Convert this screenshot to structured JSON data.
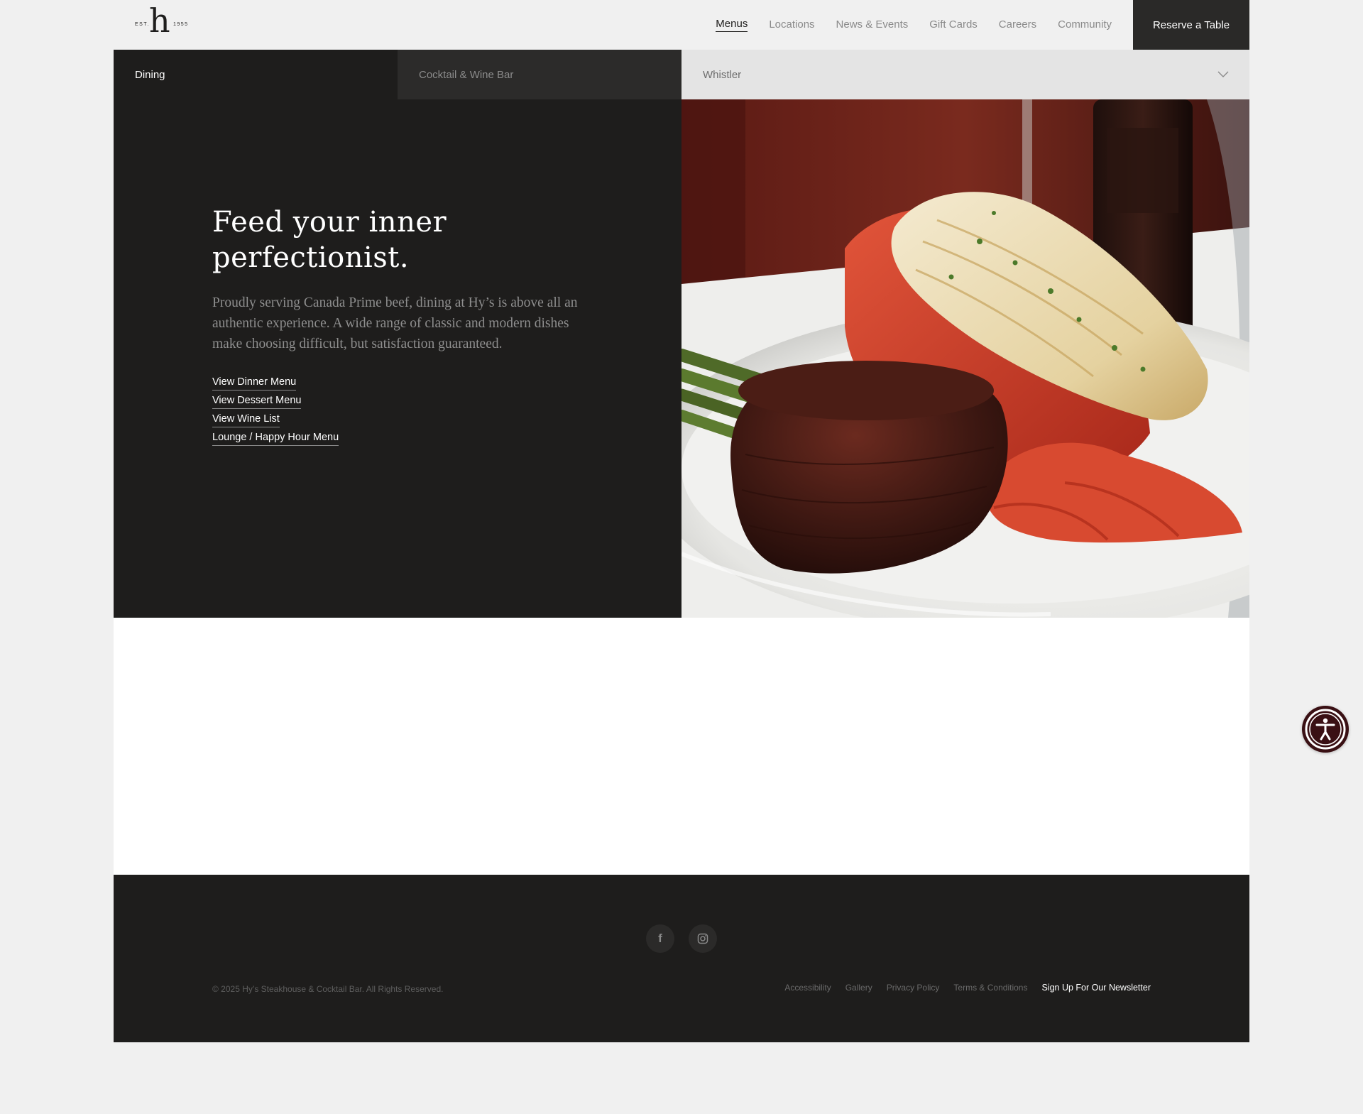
{
  "logo": {
    "est": "EST.",
    "letter": "h",
    "year": "1955"
  },
  "nav": {
    "items": [
      {
        "label": "Menus",
        "active": true
      },
      {
        "label": "Locations"
      },
      {
        "label": "News & Events"
      },
      {
        "label": "Gift Cards"
      },
      {
        "label": "Careers"
      },
      {
        "label": "Community"
      }
    ],
    "cta": "Reserve a Table"
  },
  "tabs": {
    "dining": "Dining",
    "cocktail": "Cocktail & Wine Bar",
    "location": "Whistler"
  },
  "hero": {
    "title": "Feed your inner perfectionist.",
    "text": "Proudly serving Canada Prime beef, dining at Hy’s is above all an authentic experience. A wide range of classic and modern dishes make choosing difficult, but satisfaction guaranteed.",
    "links": [
      "View Dinner Menu",
      "View Dessert Menu",
      "View Wine List",
      "Lounge / Happy Hour Menu"
    ]
  },
  "footer": {
    "social": {
      "facebook": "f"
    },
    "copyright": "© 2025 Hy’s Steakhouse & Cocktail Bar. All Rights Reserved.",
    "links": [
      "Accessibility",
      "Gallery",
      "Privacy Policy",
      "Terms & Conditions"
    ],
    "newsletter": "Sign Up For Our Newsletter"
  },
  "colors": {
    "page_bg": "#f0f0f0",
    "dark": "#1e1d1c",
    "tab_alt": "#2c2b2a",
    "select_bg": "#e4e4e4",
    "a11y": "#3a1014"
  }
}
